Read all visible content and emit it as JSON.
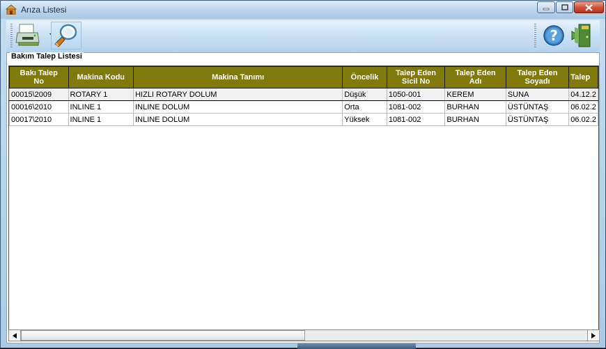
{
  "window": {
    "title": "Arıza Listesi"
  },
  "toolbar": {
    "left_icons": [
      "printer-icon",
      "dropdown-arrow-icon",
      "search-magnifier-icon"
    ],
    "right_icons": [
      "help-icon",
      "exit-door-icon"
    ]
  },
  "group": {
    "title": "Bakım Talep Listesi"
  },
  "table": {
    "columns": [
      {
        "label_line1": "Bakı Talep",
        "label_line2": "No"
      },
      {
        "label_line1": "Makina Kodu",
        "label_line2": ""
      },
      {
        "label_line1": "Makina Tanımı",
        "label_line2": ""
      },
      {
        "label_line1": "Öncelik",
        "label_line2": ""
      },
      {
        "label_line1": "Talep Eden",
        "label_line2": "Sicil No"
      },
      {
        "label_line1": "Talep Eden",
        "label_line2": "Adı"
      },
      {
        "label_line1": "Talep Eden",
        "label_line2": "Soyadı"
      },
      {
        "label_line1": "Talep",
        "label_line2": ""
      }
    ],
    "rows": [
      {
        "no": "00015\\2009",
        "kod": "ROTARY 1",
        "tanim": "HIZLI ROTARY DOLUM",
        "oncelik": "Düşük",
        "sicil": "1050-001",
        "adi": "KEREM",
        "soyadi": "SUNA",
        "tarih": "04.12.2"
      },
      {
        "no": "00016\\2010",
        "kod": "INLINE 1",
        "tanim": "INLINE DOLUM",
        "oncelik": "Orta",
        "sicil": "1081-002",
        "adi": "BURHAN",
        "soyadi": "ÜSTÜNTAŞ",
        "tarih": "06.02.2"
      },
      {
        "no": "00017\\2010",
        "kod": "INLINE 1",
        "tanim": "INLINE DOLUM",
        "oncelik": "Yüksek",
        "sicil": "1081-002",
        "adi": "BURHAN",
        "soyadi": "ÜSTÜNTAŞ",
        "tarih": "06.02.2"
      }
    ]
  },
  "colors": {
    "header_bg": "#807a0c",
    "header_text": "#ffffff",
    "window_frame": "#a9cbe4"
  }
}
